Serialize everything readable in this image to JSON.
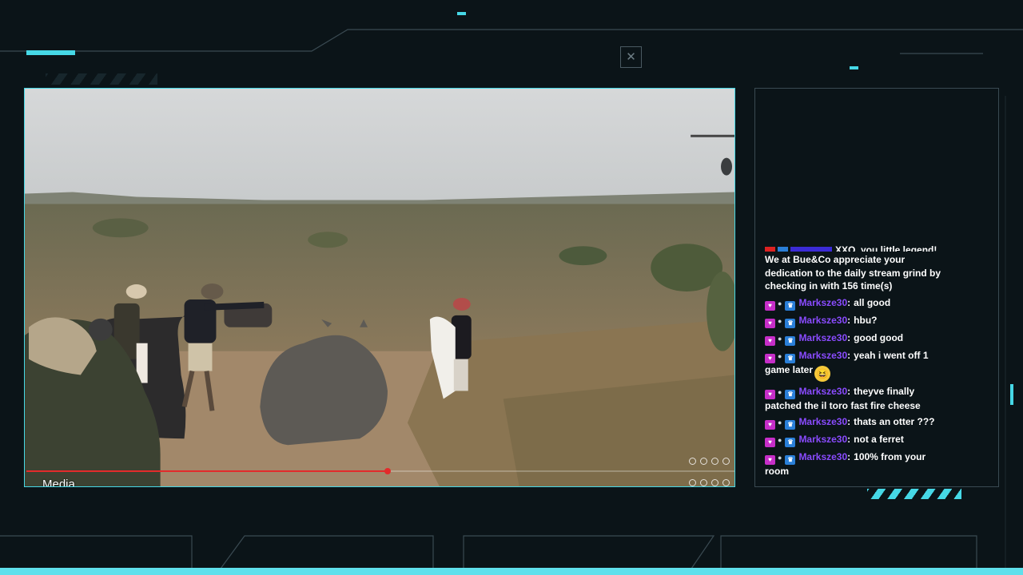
{
  "overlay": {
    "close_icon": "close-icon",
    "accent_color": "#46d8e6"
  },
  "video": {
    "caption": "Media",
    "progress": 0.51,
    "progress_color": "#e32b2b"
  },
  "chat": {
    "cutoff_text": "XXO, you little legend!",
    "messages": [
      {
        "system": true,
        "text": "We at Bue&Co appreciate your dedication to the daily stream grind by checking in with 156 time(s)"
      },
      {
        "user": "Marksze30",
        "text": "all good"
      },
      {
        "user": "Marksze30",
        "text": "hbu?"
      },
      {
        "user": "Marksze30",
        "text": "good good"
      },
      {
        "user": "Marksze30",
        "text": "yeah i went off 1 game later",
        "emoji": "😆"
      },
      {
        "user": "Marksze30",
        "text": "theyve finally patched the il toro fast fire cheese"
      },
      {
        "user": "Marksze30",
        "text": "thats an otter ???"
      },
      {
        "user": "Marksze30",
        "text": "not a ferret"
      },
      {
        "user": "Marksze30",
        "text": "100% from your room"
      }
    ],
    "badge_icons": [
      "heart-badge-icon",
      "dot-badge-icon",
      "crown-badge-icon"
    ],
    "username_color": "#8a4bff"
  }
}
